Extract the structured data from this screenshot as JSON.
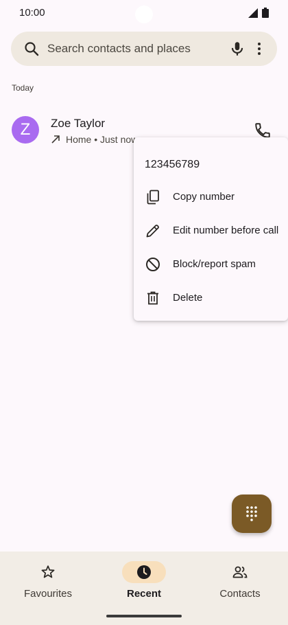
{
  "status_bar": {
    "time": "10:00"
  },
  "search": {
    "placeholder": "Search contacts and places"
  },
  "recents": {
    "section_label": "Today",
    "calls": [
      {
        "avatar_letter": "Z",
        "name": "Zoe Taylor",
        "meta": "Home • Just now",
        "direction": "outgoing"
      }
    ]
  },
  "context_menu": {
    "number": "123456789",
    "items": [
      {
        "label": "Copy number",
        "icon": "copy-icon"
      },
      {
        "label": "Edit number before call",
        "icon": "pencil-icon"
      },
      {
        "label": "Block/report spam",
        "icon": "block-icon"
      },
      {
        "label": "Delete",
        "icon": "trash-icon"
      }
    ]
  },
  "bottom_nav": {
    "items": [
      {
        "label": "Favourites",
        "icon": "star-icon",
        "selected": false
      },
      {
        "label": "Recent",
        "icon": "clock-icon",
        "selected": true
      },
      {
        "label": "Contacts",
        "icon": "people-icon",
        "selected": false
      }
    ]
  },
  "colors": {
    "background": "#fdf8fc",
    "avatar": "#a96bf0",
    "fab": "#7b5a26",
    "nav_selected_pill": "#f8dfbc",
    "search_bar": "#efe9e0"
  }
}
